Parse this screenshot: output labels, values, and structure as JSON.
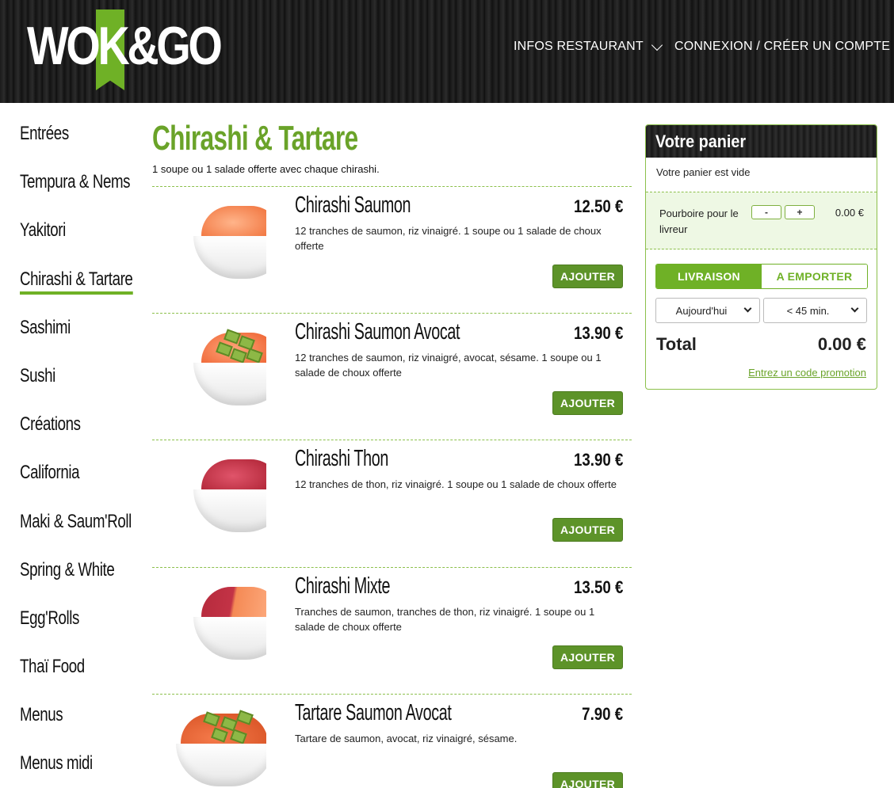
{
  "colors": {
    "accent": "#6fb126",
    "button": "#5d9329",
    "header_bg": "#1c1c1c"
  },
  "header": {
    "logo_text": "WOK&GO",
    "nav_infos": "INFOS RESTAURANT",
    "nav_login": "CONNEXION / CRÉER UN COMPTE"
  },
  "sidebar": {
    "items": [
      {
        "label": "Entrées"
      },
      {
        "label": "Tempura & Nems"
      },
      {
        "label": "Yakitori"
      },
      {
        "label": "Chirashi & Tartare",
        "active": true
      },
      {
        "label": "Sashimi"
      },
      {
        "label": "Sushi"
      },
      {
        "label": "Créations"
      },
      {
        "label": "California"
      },
      {
        "label": "Maki & Saum'Roll"
      },
      {
        "label": "Spring & White"
      },
      {
        "label": "Egg'Rolls"
      },
      {
        "label": "Thaï Food"
      },
      {
        "label": "Menus"
      },
      {
        "label": "Menus midi"
      }
    ]
  },
  "main": {
    "title": "Chirashi & Tartare",
    "subtitle": "1 soupe ou 1 salade offerte avec chaque chirashi.",
    "add_label": "AJOUTER",
    "products": [
      {
        "name": "Chirashi Saumon",
        "price": "12.50 €",
        "desc": "12 tranches de saumon, riz vinaigré. 1 soupe ou 1 salade de choux offerte",
        "image": "salmon-bowl"
      },
      {
        "name": "Chirashi Saumon Avocat",
        "price": "13.90 €",
        "desc": "12 tranches de saumon, riz vinaigré, avocat, sésame. 1 soupe ou 1 salade de choux offerte",
        "image": "salmon-avocado-bowl"
      },
      {
        "name": "Chirashi Thon",
        "price": "13.90 €",
        "desc": "12 tranches de thon, riz vinaigré. 1 soupe ou 1 salade de choux offerte",
        "image": "tuna-bowl"
      },
      {
        "name": "Chirashi Mixte",
        "price": "13.50 €",
        "desc": "Tranches de saumon, tranches de thon, riz vinaigré. 1 soupe ou 1 salade de choux offerte",
        "image": "mixed-bowl"
      },
      {
        "name": "Tartare Saumon Avocat",
        "price": "7.90 €",
        "desc": "Tartare de saumon, avocat, riz vinaigré, sésame.",
        "image": "tartare-bowl"
      }
    ]
  },
  "cart": {
    "title": "Votre panier",
    "empty_text": "Votre panier est vide",
    "tip_label": "Pourboire pour le livreur",
    "tip_minus": "-",
    "tip_plus": "+",
    "tip_value": "0.00 €",
    "tab_delivery": "LIVRAISON",
    "tab_takeaway": "A EMPORTER",
    "day_select": "Aujourd'hui",
    "time_select": "< 45 min.",
    "total_label": "Total",
    "total_value": "0.00 €",
    "promo_link": "Entrez un code promotion"
  }
}
